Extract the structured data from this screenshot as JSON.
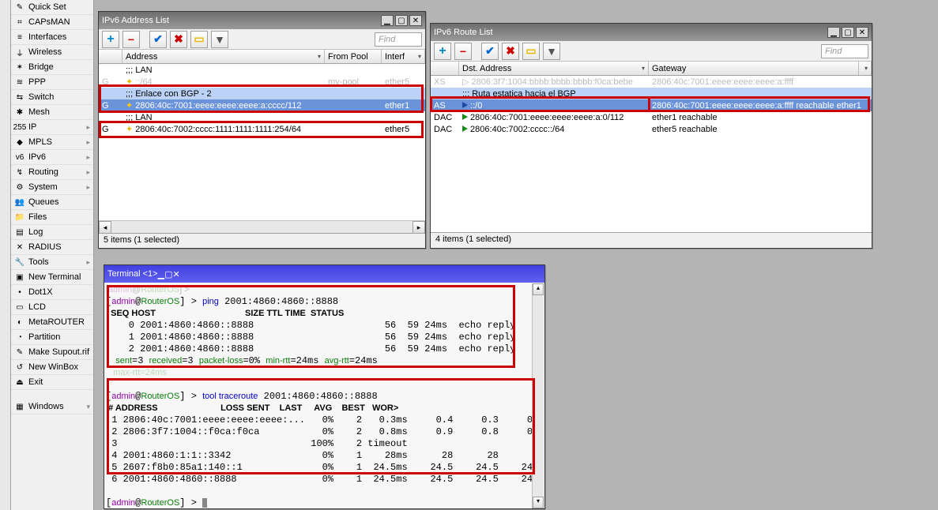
{
  "sidebar": {
    "items": [
      {
        "label": "Quick Set",
        "icon": "✎"
      },
      {
        "label": "CAPsMAN",
        "icon": "⌗"
      },
      {
        "label": "Interfaces",
        "icon": "≡"
      },
      {
        "label": "Wireless",
        "icon": "⏚"
      },
      {
        "label": "Bridge",
        "icon": "✶"
      },
      {
        "label": "PPP",
        "icon": "≋"
      },
      {
        "label": "Switch",
        "icon": "⇆"
      },
      {
        "label": "Mesh",
        "icon": "✱"
      },
      {
        "label": "IP",
        "icon": "255",
        "arrow": true
      },
      {
        "label": "MPLS",
        "icon": "◆",
        "arrow": true
      },
      {
        "label": "IPv6",
        "icon": "v6",
        "arrow": true
      },
      {
        "label": "Routing",
        "icon": "↯",
        "arrow": true
      },
      {
        "label": "System",
        "icon": "⚙",
        "arrow": true
      },
      {
        "label": "Queues",
        "icon": "👥"
      },
      {
        "label": "Files",
        "icon": "📁"
      },
      {
        "label": "Log",
        "icon": "▤"
      },
      {
        "label": "RADIUS",
        "icon": "✕"
      },
      {
        "label": "Tools",
        "icon": "🔧",
        "arrow": true
      },
      {
        "label": "New Terminal",
        "icon": "▣"
      },
      {
        "label": "Dot1X",
        "icon": "•"
      },
      {
        "label": "LCD",
        "icon": "▭"
      },
      {
        "label": "MetaROUTER",
        "icon": "◐"
      },
      {
        "label": "Partition",
        "icon": "◔"
      },
      {
        "label": "Make Supout.rif",
        "icon": "✎"
      },
      {
        "label": "New WinBox",
        "icon": "↺"
      },
      {
        "label": "Exit",
        "icon": "⏏"
      }
    ],
    "windows_label": "Windows"
  },
  "addrWin": {
    "title": "IPv6 Address List",
    "find": "Find",
    "cols": {
      "address": "Address",
      "fromPool": "From Pool",
      "iface": "Interf"
    },
    "rows": [
      {
        "type": "comment",
        "text": ";;; LAN"
      },
      {
        "type": "faded",
        "flag": "G",
        "addr": "::/64",
        "pool": "my-pool",
        "iface": "ether5"
      },
      {
        "type": "comment_hl",
        "text": ";;; Enlace con BGP - 2"
      },
      {
        "type": "sel",
        "flag": "G",
        "addr": "2806:40c:7001:eeee:eeee:eeee:a:cccc/112",
        "pool": "",
        "iface": "ether1"
      },
      {
        "type": "comment",
        "text": ";;; LAN"
      },
      {
        "type": "data",
        "flag": "G",
        "addr": "2806:40c:7002:cccc:1111:1111:1111:254/64",
        "pool": "",
        "iface": "ether5"
      }
    ],
    "status": "5 items (1 selected)"
  },
  "routeWin": {
    "title": "IPv6 Route List",
    "find": "Find",
    "cols": {
      "dst": "Dst. Address",
      "gw": "Gateway"
    },
    "rows": [
      {
        "type": "faded",
        "flag": "XS",
        "dst": "2806:3f7:1004:bbbb:bbbb:bbbb:f0ca:bebe",
        "gw": "2806:40c:7001:eeee:eeee:eeee:a:ffff"
      },
      {
        "type": "comment_hl",
        "text": ";;; Ruta estatica hacia el BGP"
      },
      {
        "type": "sel",
        "flag": "AS",
        "dst": "::/0",
        "gw": "2806:40c:7001:eeee:eeee:eeee:a:ffff reachable ether1"
      },
      {
        "type": "data",
        "flag": "DAC",
        "dst": "2806:40c:7001:eeee:eeee:eeee:a:0/112",
        "gw": "ether1 reachable"
      },
      {
        "type": "data",
        "flag": "DAC",
        "dst": "2806:40c:7002:cccc::/64",
        "gw": "ether5 reachable"
      }
    ],
    "status": "4 items (1 selected)"
  },
  "term": {
    "title": "Terminal <1>",
    "lines": [
      {
        "pre": "[",
        "u": "admin",
        "at": "@",
        "h": "RouterOS",
        "post": "] > ",
        "cmd": "",
        "faded": true
      },
      {
        "pre": "[",
        "u": "admin",
        "at": "@",
        "h": "RouterOS",
        "post": "] > ",
        "cmd": "ping",
        "args": " 2001:4860:4860::8888"
      },
      {
        "raw": "  SEQ HOST                                     SIZE TTL TIME  STATUS",
        "bold": true
      },
      {
        "raw": "    0 2001:4860:4860::8888                       56  59 24ms  echo reply"
      },
      {
        "raw": "    1 2001:4860:4860::8888                       56  59 24ms  echo reply"
      },
      {
        "raw": "    2 2001:4860:4860::8888                       56  59 24ms  echo reply"
      },
      {
        "stats": true,
        "s": "    sent",
        "sv": "=3 ",
        "r": "received",
        "rv": "=3 ",
        "p": "packet-loss",
        "pv": "=0% ",
        "m": "min-rtt",
        "mv": "=24ms ",
        "a": "avg-rtt",
        "av": "=24ms"
      },
      {
        "raw": "   max-rtt=24ms",
        "faded": true,
        "green": true
      },
      {
        "raw": ""
      },
      {
        "pre": "[",
        "u": "admin",
        "at": "@",
        "h": "RouterOS",
        "post": "] > ",
        "cmd": "tool traceroute",
        "args": " 2001:4860:4860::8888"
      },
      {
        "raw": " # ADDRESS                          LOSS SENT    LAST     AVG    BEST   WOR>",
        "bold": true
      },
      {
        "raw": " 1 2806:40c:7001:eeee:eeee:eeee:...   0%    2   0.3ms     0.4     0.3     0>"
      },
      {
        "raw": " 2 2806:3f7:1004::f0ca:f0ca           0%    2   0.8ms     0.9     0.8     0>"
      },
      {
        "raw": " 3                                  100%    2 timeout"
      },
      {
        "raw": " 4 2001:4860:1:1::3342                0%    1    28ms      28      28      >"
      },
      {
        "raw": " 5 2607:f8b0:85a1:140::1              0%    1  24.5ms    24.5    24.5    24>"
      },
      {
        "raw": " 6 2001:4860:4860::8888               0%    1  24.5ms    24.5    24.5    24>"
      },
      {
        "raw": ""
      },
      {
        "pre": "[",
        "u": "admin",
        "at": "@",
        "h": "RouterOS",
        "post": "] > ",
        "cmd": "",
        "cursor": true
      }
    ]
  }
}
